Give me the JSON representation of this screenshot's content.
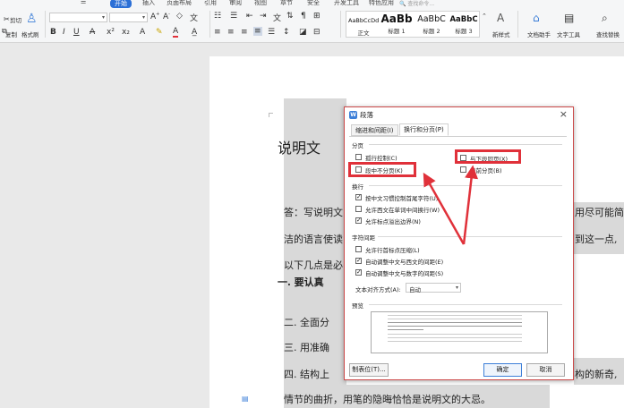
{
  "ribbon": {
    "tabs": [
      "开始",
      "插入",
      "页面布局",
      "引用",
      "审阅",
      "视图",
      "章节",
      "安全",
      "开发工具",
      "特色应用"
    ],
    "active_tab": "开始",
    "search_placeholder": "查找命令...",
    "cut": "剪切",
    "copy": "复制",
    "format_painter": "格式刷",
    "styles": [
      {
        "preview": "AaBbCcDd",
        "name": "正文"
      },
      {
        "preview": "AaBb",
        "name": "标题 1"
      },
      {
        "preview": "AaBbC",
        "name": "标题 2"
      },
      {
        "preview": "AaBbC",
        "name": "标题 3"
      }
    ],
    "new_style": "新样式",
    "doc_assistant": "文档助手",
    "text_tools": "文字工具",
    "find_replace": "查找替换"
  },
  "document": {
    "heading": "说明文",
    "line1_a": "答：写说明文",
    "line1_b": "用尽可能简",
    "line2_a": "洁的语言使读",
    "line2_b": "到这一点,",
    "line3": "以下几点是必",
    "item1": "一. 要认真",
    "item2": "二. 全面分",
    "item3": "三. 用准确",
    "item4_a": "四. 结构上",
    "item4_b": "构的新奇,",
    "line_last": "情节的曲折，用笔的隐晦恰恰是说明文的大忌。"
  },
  "dialog": {
    "title": "段落",
    "icon_letter": "W",
    "tabs": [
      "缩进和间距(I)",
      "换行和分页(P)"
    ],
    "active_tab": "换行和分页(P)",
    "pagination": {
      "label": "分页",
      "widow_control": {
        "label": "孤行控制(C)",
        "checked": false
      },
      "keep_with_next": {
        "label": "与下段同页(X)",
        "checked": false
      },
      "keep_lines_together": {
        "label": "段中不分页(K)",
        "checked": false
      },
      "page_break_before": {
        "label": "段前分页(B)",
        "checked": false
      }
    },
    "line_break": {
      "label": "换行",
      "chinese_rules": {
        "label": "按中文习惯控制首尾字符(U)",
        "checked": true
      },
      "word_wrap": {
        "label": "允许西文在单词中间换行(W)",
        "checked": false
      },
      "punctuation_overflow": {
        "label": "允许标点溢出边界(N)",
        "checked": true
      }
    },
    "char_spacing": {
      "label": "字符间距",
      "compress_punct": {
        "label": "允许行首标点压缩(L)",
        "checked": false
      },
      "auto_space_western": {
        "label": "自动调整中文与西文的间距(E)",
        "checked": true
      },
      "auto_space_digits": {
        "label": "自动调整中文与数字的间距(S)",
        "checked": true
      },
      "text_align_label": "文本对齐方式(A):",
      "text_align_value": "自动"
    },
    "preview_label": "预览",
    "tabs_button": "制表位(T)...",
    "ok": "确定",
    "cancel": "取消"
  },
  "colors": {
    "accent": "#2b6fd6",
    "annotation_red": "#e0313a",
    "selection_gray": "#d9d9d9"
  }
}
